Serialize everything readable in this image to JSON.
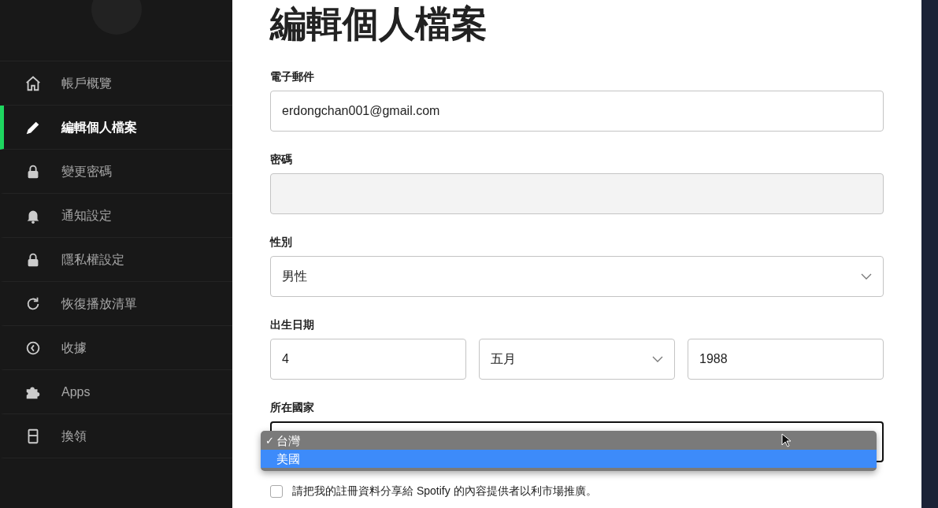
{
  "sidebar": {
    "items": [
      {
        "label": "帳戶概覽",
        "selected": false
      },
      {
        "label": "編輯個人檔案",
        "selected": true
      },
      {
        "label": "變更密碼",
        "selected": false
      },
      {
        "label": "通知設定",
        "selected": false
      },
      {
        "label": "隱私權設定",
        "selected": false
      },
      {
        "label": "恢復播放清單",
        "selected": false
      },
      {
        "label": "收據",
        "selected": false
      },
      {
        "label": "Apps",
        "selected": false
      },
      {
        "label": "換領",
        "selected": false
      }
    ]
  },
  "page": {
    "title": "編輯個人檔案"
  },
  "form": {
    "fields": [
      {
        "kind": "input",
        "label": "電子郵件",
        "value": "erdongchan001@gmail.com"
      },
      {
        "kind": "input",
        "label": "密碼",
        "disabled": true
      },
      {
        "kind": "select",
        "label": "性別",
        "value": "男性"
      },
      {
        "kind": "date",
        "label": "出生日期",
        "parts": [
          {
            "kind": "input",
            "value": "4"
          },
          {
            "kind": "select",
            "value": "五月"
          },
          {
            "kind": "input",
            "value": "1988"
          }
        ]
      },
      {
        "kind": "select",
        "label": "所在國家",
        "expanded": true,
        "check_mark": "✓",
        "options": [
          {
            "label": "台灣",
            "selected": true,
            "highlighted": false
          },
          {
            "label": "美國",
            "selected": false,
            "highlighted": true
          }
        ]
      }
    ],
    "share_checkbox": {
      "label": "請把我的註冊資料分享給 Spotify 的內容提供者以利市場推廣。",
      "checked": false
    }
  }
}
